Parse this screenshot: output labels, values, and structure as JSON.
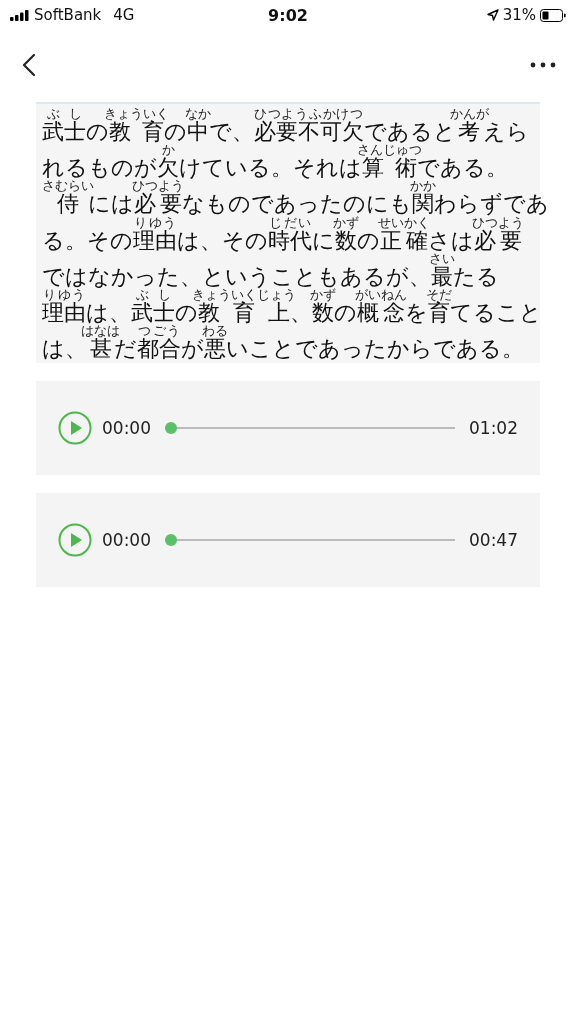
{
  "status_bar": {
    "carrier": "SoftBank",
    "network": "4G",
    "time": "9:02",
    "battery": "31%"
  },
  "passage": {
    "lines": [
      [
        {
          "t": "武士",
          "r": "ぶし"
        },
        {
          "t": "の"
        },
        {
          "t": "教育",
          "r": "きょういく"
        },
        {
          "t": "の"
        },
        {
          "t": "中",
          "r": "なか"
        },
        {
          "t": "で、"
        },
        {
          "t": "必要不可欠",
          "r": "ひつようふかけつ"
        },
        {
          "t": "であると"
        },
        {
          "t": "考",
          "r": "かんが"
        },
        {
          "t": "えら"
        }
      ],
      [
        {
          "t": "れるものが"
        },
        {
          "t": "欠",
          "r": "か"
        },
        {
          "t": "けている。それは"
        },
        {
          "t": "算術",
          "r": "さんじゅつ"
        },
        {
          "t": "である。"
        }
      ],
      [
        {
          "t": "侍",
          "r": "さむらい"
        },
        {
          "t": "には"
        },
        {
          "t": "必要",
          "r": "ひつよう"
        },
        {
          "t": "なものであったのにも"
        },
        {
          "t": "関",
          "r": "かか"
        },
        {
          "t": "わらずであ"
        }
      ],
      [
        {
          "t": "る。その"
        },
        {
          "t": "理由",
          "r": "りゆう"
        },
        {
          "t": "は、その"
        },
        {
          "t": "時代",
          "r": "じだい"
        },
        {
          "t": "に"
        },
        {
          "t": "数",
          "r": "かず"
        },
        {
          "t": "の"
        },
        {
          "t": "正確",
          "r": "せいかく"
        },
        {
          "t": "さは"
        },
        {
          "t": "必要",
          "r": "ひつよう"
        }
      ],
      [
        {
          "t": "ではなかった、ということもあるが、"
        },
        {
          "t": "最",
          "r": "さい"
        },
        {
          "t": "たる"
        }
      ],
      [
        {
          "t": "理由",
          "r": "りゆう"
        },
        {
          "t": "は、"
        },
        {
          "t": "武士",
          "r": "ぶし"
        },
        {
          "t": "の"
        },
        {
          "t": "教育上",
          "r": "きょういくじょう"
        },
        {
          "t": "、"
        },
        {
          "t": "数",
          "r": "かず"
        },
        {
          "t": "の"
        },
        {
          "t": "概念",
          "r": "がいねん"
        },
        {
          "t": "を"
        },
        {
          "t": "育",
          "r": "そだ"
        },
        {
          "t": "てること"
        }
      ],
      [
        {
          "t": "は、"
        },
        {
          "t": "甚",
          "r": "はなは"
        },
        {
          "t": "だ"
        },
        {
          "t": "都合",
          "r": "つごう"
        },
        {
          "t": "が"
        },
        {
          "t": "悪",
          "r": "わる"
        },
        {
          "t": "いことであったからである。"
        }
      ]
    ]
  },
  "players": [
    {
      "current": "00:00",
      "duration": "01:02",
      "level": 0
    },
    {
      "current": "00:00",
      "duration": "00:47",
      "level": 0
    }
  ]
}
